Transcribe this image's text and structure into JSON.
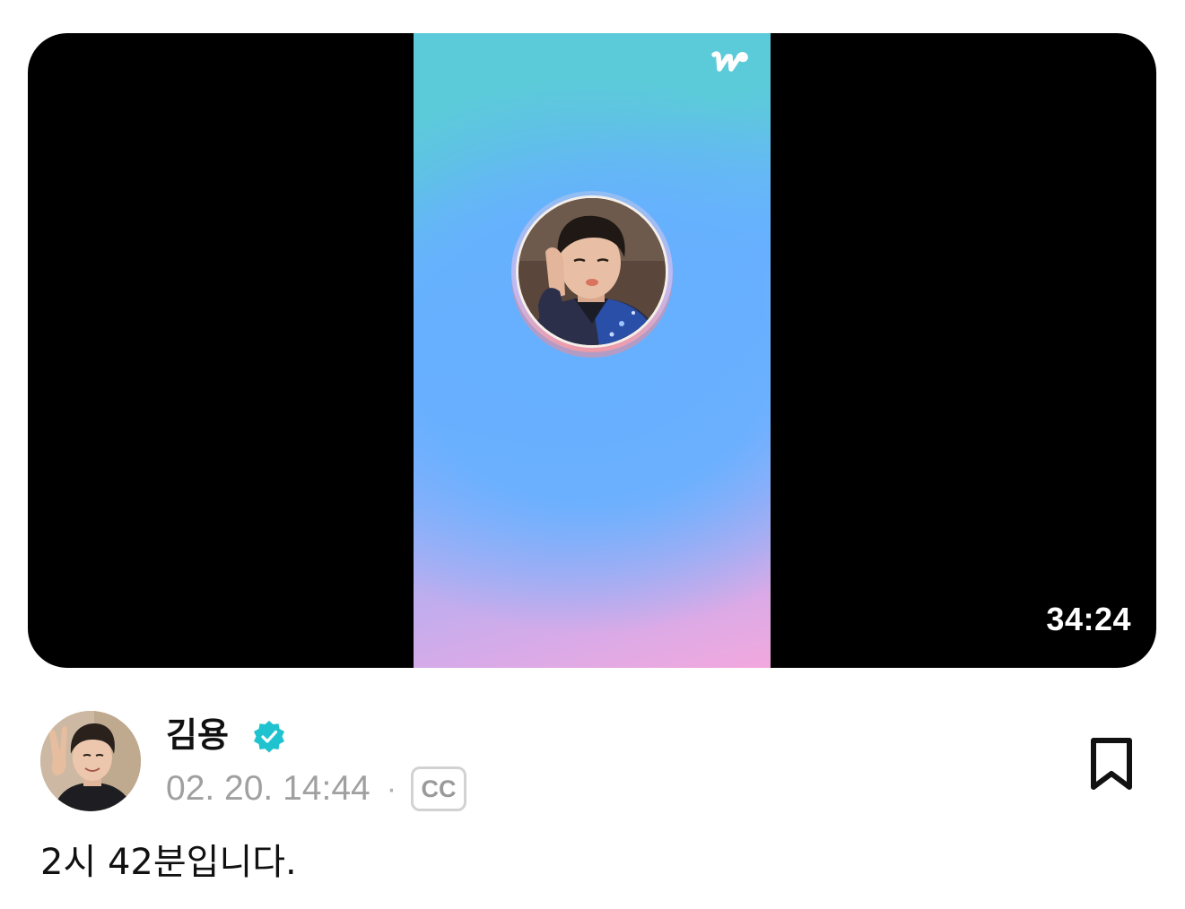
{
  "video": {
    "duration": "34:24",
    "brand_logo_icon": "weverse-logo-icon",
    "frame_gradient_colors": [
      "#5ccbd9",
      "#6ab1ff",
      "#f2a8de"
    ]
  },
  "author": {
    "name": "김용",
    "verified_icon": "verified-badge-icon",
    "verified_color": "#1fc3cf",
    "avatar_icon": "avatar"
  },
  "post": {
    "date": "02. 20. 14:44",
    "separator": "·",
    "cc_label": "CC",
    "body": "2시 42분입니다."
  },
  "actions": {
    "bookmark_icon": "bookmark-icon"
  }
}
